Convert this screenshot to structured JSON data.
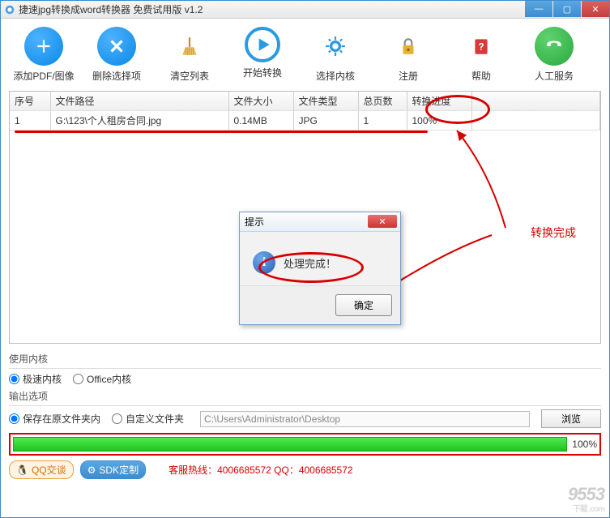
{
  "window": {
    "title": "捷速jpg转换成word转换器 免费试用版 v1.2"
  },
  "toolbar": {
    "add": "添加PDF/图像",
    "del": "删除选择项",
    "clear": "清空列表",
    "start": "开始转换",
    "kernel": "选择内核",
    "register": "注册",
    "help": "帮助",
    "human": "人工服务"
  },
  "table": {
    "headers": {
      "seq": "序号",
      "path": "文件路径",
      "size": "文件大小",
      "type": "文件类型",
      "pages": "总页数",
      "progress": "转换进度"
    },
    "rows": [
      {
        "seq": "1",
        "path": "G:\\123\\个人租房合同.jpg",
        "size": "0.14MB",
        "type": "JPG",
        "pages": "1",
        "progress": "100%"
      }
    ]
  },
  "annotation": {
    "done": "转换完成"
  },
  "dialog": {
    "title": "提示",
    "message": "处理完成！",
    "ok": "确定"
  },
  "kernel_section": {
    "label": "使用内核",
    "fast": "极速内核",
    "office": "Office内核"
  },
  "output_section": {
    "label": "输出选项",
    "save_orig": "保存在原文件夹内",
    "custom": "自定义文件夹",
    "path": "C:\\Users\\Administrator\\Desktop",
    "browse": "浏览"
  },
  "progress": {
    "pct": "100%"
  },
  "footer": {
    "qq": "QQ交谈",
    "sdk": "SDK定制",
    "hotline": "客服热线：4006685572 QQ：4006685572"
  },
  "watermark": {
    "main": "9553",
    "sub": "下载 .com"
  }
}
